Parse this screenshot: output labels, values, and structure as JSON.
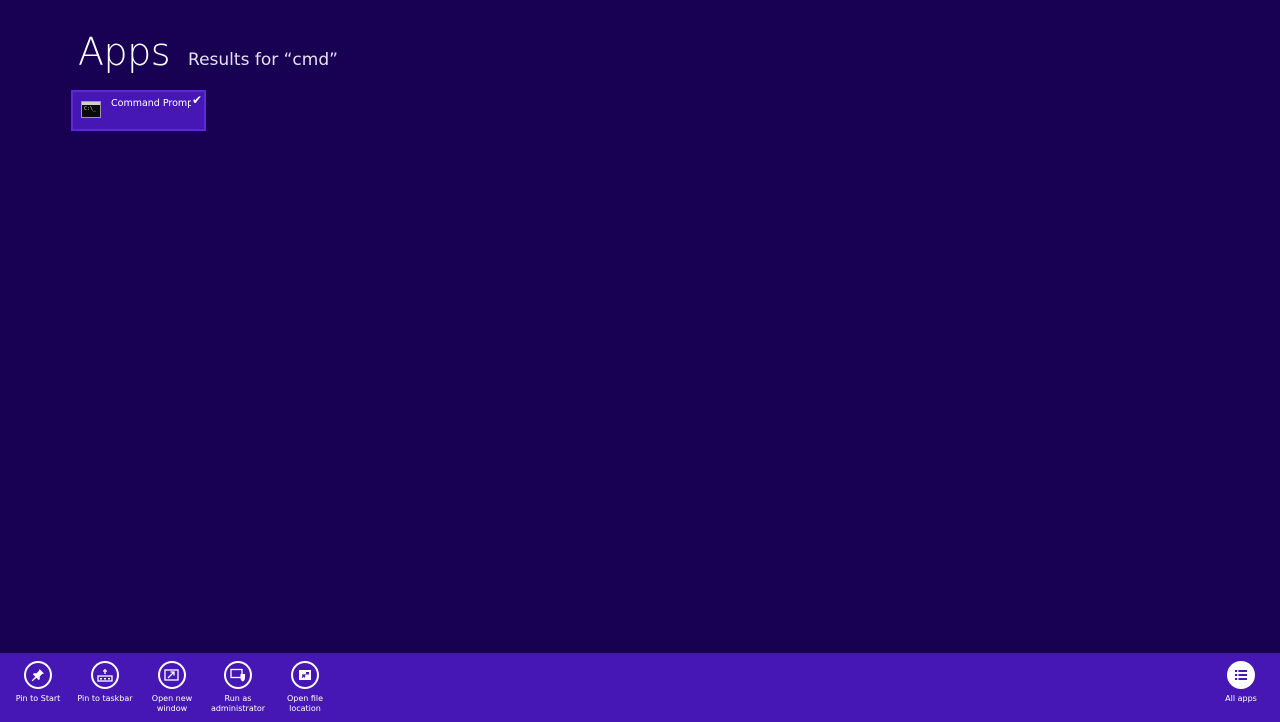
{
  "header": {
    "title": "Apps",
    "subtitle": "Results for “cmd”"
  },
  "results": [
    {
      "label": "Command Prompt",
      "icon": "console-icon",
      "prompt_text": "C:\\_",
      "selected": true
    }
  ],
  "appbar": {
    "commands": [
      {
        "id": "pin-to-start",
        "label": "Pin to Start",
        "icon": "pin-icon"
      },
      {
        "id": "pin-to-taskbar",
        "label": "Pin to taskbar",
        "icon": "taskbar-pin-icon"
      },
      {
        "id": "open-new-window",
        "label": "Open new\nwindow",
        "icon": "new-window-icon"
      },
      {
        "id": "run-as-administrator",
        "label": "Run as\nadministrator",
        "icon": "shield-window-icon"
      },
      {
        "id": "open-file-location",
        "label": "Open file\nlocation",
        "icon": "folder-icon"
      }
    ],
    "right_commands": [
      {
        "id": "all-apps",
        "label": "All apps",
        "icon": "list-icon"
      }
    ]
  },
  "colors": {
    "background": "#180052",
    "accent": "#4617b4",
    "text": "#ffffff"
  }
}
